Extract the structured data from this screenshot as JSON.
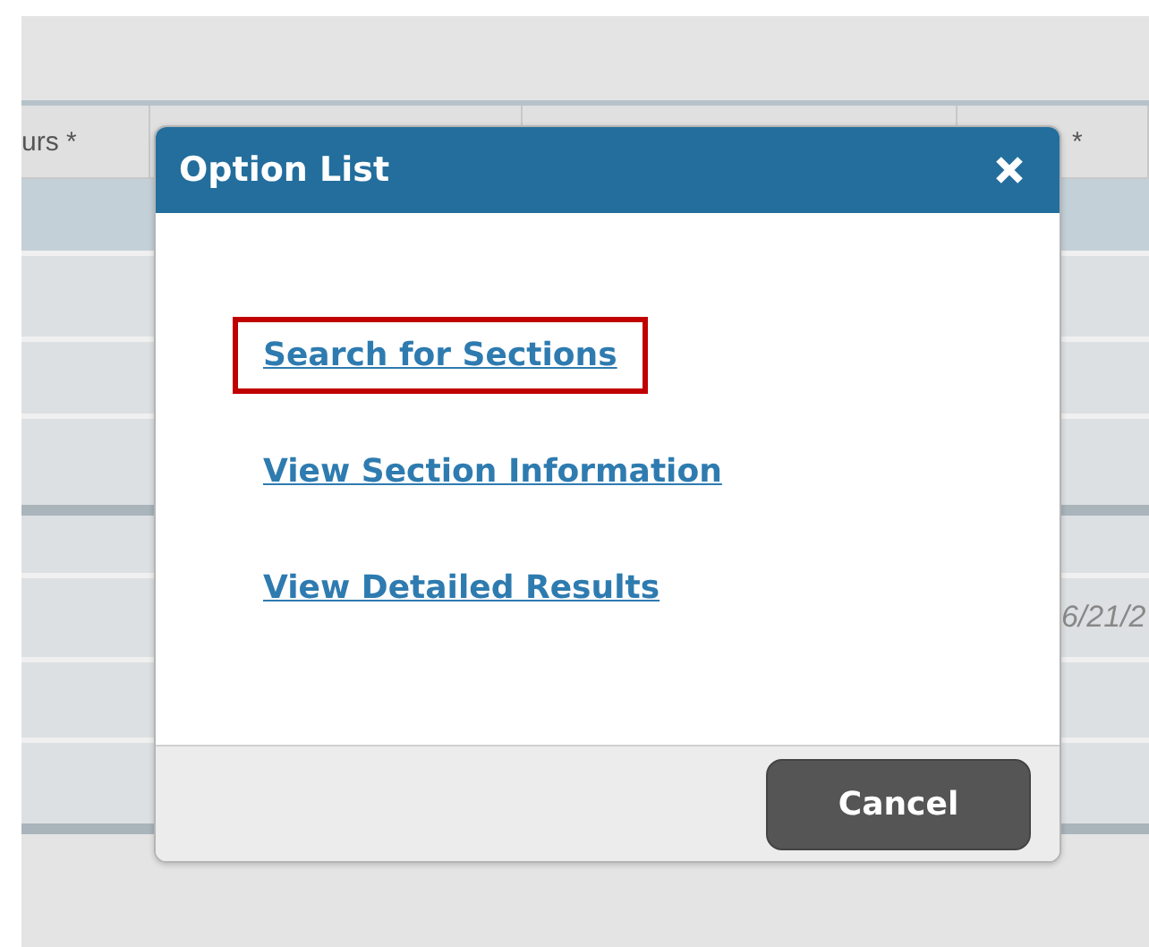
{
  "background_table": {
    "header": {
      "column_1": "urs *",
      "column_4": "*"
    },
    "groups": [
      {
        "rows": [
          {
            "selected": true
          },
          {
            "selected": false
          },
          {
            "selected": false
          },
          {
            "selected": false
          }
        ]
      },
      {
        "rows": [
          {
            "selected": false
          },
          {
            "selected": false,
            "column_4": "6/21/2"
          },
          {
            "selected": false
          },
          {
            "selected": false
          }
        ]
      }
    ]
  },
  "dialog": {
    "title": "Option List",
    "links": [
      {
        "label": "Search for Sections",
        "highlighted": true
      },
      {
        "label": "View Section Information",
        "highlighted": false
      },
      {
        "label": "View Detailed Results",
        "highlighted": false
      }
    ],
    "buttons": [
      {
        "label": "Cancel",
        "kind": "secondary"
      }
    ]
  }
}
